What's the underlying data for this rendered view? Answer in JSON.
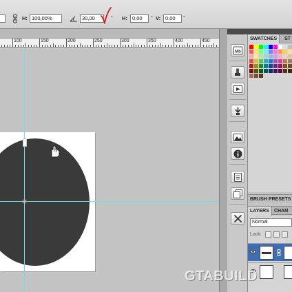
{
  "options_bar": {
    "height_label": "H:",
    "height_value": "100,00%",
    "angle_value": "30,00",
    "angle_unit": "°",
    "skew_h_label": "H:",
    "skew_h_value": "0,00",
    "skew_h_unit": "°",
    "skew_v_label": "V:",
    "skew_v_value": "0,00",
    "skew_v_unit": "°",
    "icons": [
      "link-icon",
      "rotate-angle-icon",
      "handwritten-checkmark"
    ]
  },
  "ruler": {
    "labels": [
      "100",
      "150",
      "200",
      "250",
      "300",
      "350",
      "400",
      "450"
    ]
  },
  "canvas": {
    "guide_color": "#5fe7e7",
    "shape_color": "#3a3a3a",
    "cursor_icon": "rotate-cursor-icon"
  },
  "dock": {
    "icons": [
      "mini-bridge-icon",
      "clone-source-icon",
      "actions-play-icon",
      "tool-presets-icon",
      "navigator-icon",
      "info-icon",
      "notes-icon",
      "history-icon",
      "tools-icon"
    ],
    "mini_bridge_label": "Mb"
  },
  "panels": {
    "collapse_arrows": "«",
    "swatches_tab": "SWATCHES",
    "styles_tab": "ST",
    "brush_presets_tab": "BRUSH PRESETS",
    "layers_tab": "LAYERS",
    "channels_tab": "CHAN",
    "blend_mode": "Normal",
    "lock_label": "Lock:"
  },
  "swatch_colors": [
    "#ff0000",
    "#ffff00",
    "#00ff00",
    "#00ffff",
    "#0000ff",
    "#ff00ff",
    "#ffffff",
    "#e0e0e0",
    "#c0c0c0",
    "#ff5a5a",
    "#ffe66e",
    "#7eff7e",
    "#6ef0ff",
    "#6e8cff",
    "#ff6ee6",
    "#ff9b3c",
    "#ffcc66",
    "#ffdf9e",
    "#f7a8a8",
    "#f3ed9a",
    "#b8e6a0",
    "#9ad8d0",
    "#9ab6e6",
    "#c8a0e0",
    "#f0b0cc",
    "#f0d0b0",
    "#d8c8a8",
    "#e05050",
    "#e0c030",
    "#60c060",
    "#30b0b8",
    "#3070d0",
    "#a050c0",
    "#e04090",
    "#c07850",
    "#a08060",
    "#b02020",
    "#a09000",
    "#208a30",
    "#008888",
    "#1040a0",
    "#702090",
    "#a01060",
    "#8a4a20",
    "#6a5030",
    "#701010",
    "#605000",
    "#0a5a1a",
    "#005858",
    "#0a2a70",
    "#4a1060",
    "#60083a",
    "#5a3010",
    "#3e2a14",
    "#a07050",
    "#7a5030",
    "#5a3818"
  ],
  "watermark": "GTABUILD"
}
